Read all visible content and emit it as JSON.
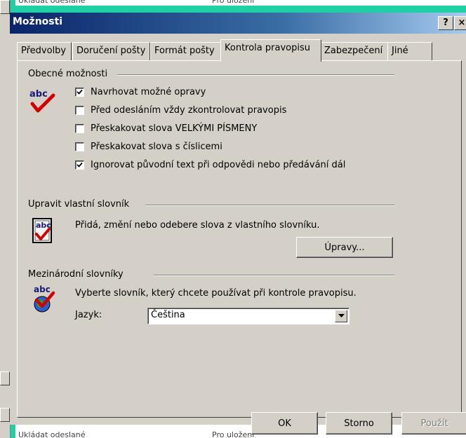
{
  "background": {
    "ghost_left_text": "Ukládat odeslané",
    "ghost_right_text": "Pro uložení"
  },
  "dialog": {
    "title": "Možnosti",
    "help_button": "?",
    "close_button": "×"
  },
  "tabs": [
    {
      "label": "Předvolby",
      "active": false
    },
    {
      "label": "Doručení pošty",
      "active": false
    },
    {
      "label": "Formát pošty",
      "active": false
    },
    {
      "label": "Kontrola pravopisu",
      "active": true
    },
    {
      "label": "Zabezpečení",
      "active": false
    },
    {
      "label": "Jiné",
      "active": false
    }
  ],
  "general": {
    "heading": "Obecné možnosti",
    "icon": "abc-checkmark-icon",
    "options": [
      {
        "label": "Navrhovat možné opravy",
        "checked": true
      },
      {
        "label": "Před odesláním vždy zkontrolovat pravopis",
        "checked": false
      },
      {
        "label": "Přeskakovat slova VELKÝMI PÍSMENY",
        "checked": false
      },
      {
        "label": "Přeskakovat slova s číslicemi",
        "checked": false
      },
      {
        "label": "Ignorovat původní text při odpovědi nebo předávání dál",
        "checked": true
      }
    ]
  },
  "custom_dictionary": {
    "heading": "Upravit vlastní slovník",
    "icon": "dictionary-book-icon",
    "description": "Přidá, změní nebo odebere slova z vlastního slovníku.",
    "edit_button": "Úpravy..."
  },
  "international": {
    "heading": "Mezinárodní slovníky",
    "icon": "globe-abc-icon",
    "description": "Vyberte slovník, který chcete používat při kontrole pravopisu.",
    "language_label": "Jazyk:",
    "language_value": "Čeština"
  },
  "footer": {
    "ok": "OK",
    "cancel": "Storno",
    "apply": "Použít"
  },
  "colors": {
    "frame_accent": "#1fd0a4",
    "titlebar": "#0a246a",
    "check_red": "#d40000",
    "dialog_face": "#d4d0c8"
  }
}
